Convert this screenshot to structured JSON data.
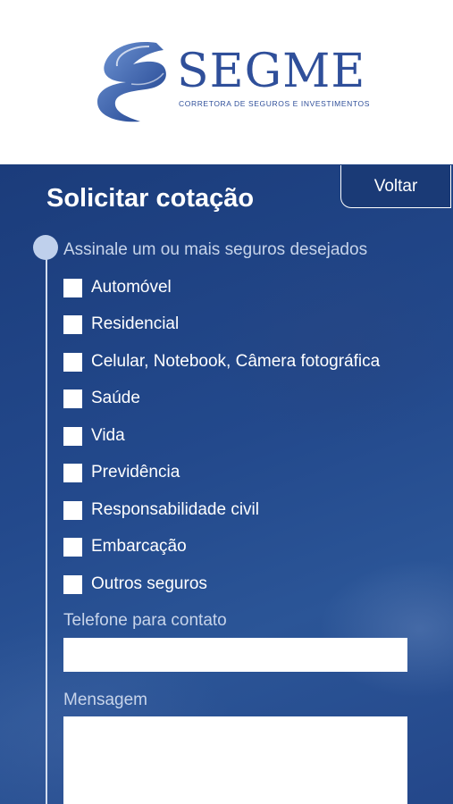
{
  "brand": {
    "name": "SEGME",
    "tagline": "CORRETORA DE SEGUROS E INVESTIMENTOS",
    "color": "#2f4f9a"
  },
  "form": {
    "title": "Solicitar cotação",
    "back_label": "Voltar",
    "prompt": "Assinale um ou mais seguros desejados",
    "options": [
      {
        "label": "Automóvel",
        "checked": false
      },
      {
        "label": "Residencial",
        "checked": false
      },
      {
        "label": "Celular, Notebook, Câmera fotográfica",
        "checked": false
      },
      {
        "label": "Saúde",
        "checked": false
      },
      {
        "label": "Vida",
        "checked": false
      },
      {
        "label": "Previdência",
        "checked": false
      },
      {
        "label": "Responsabilidade civil",
        "checked": false
      },
      {
        "label": "Embarcação",
        "checked": false
      },
      {
        "label": "Outros seguros",
        "checked": false
      }
    ],
    "phone_label": "Telefone para contato",
    "phone_value": "",
    "message_label": "Mensagem",
    "message_value": ""
  },
  "colors": {
    "panel": "#23498c",
    "accent": "#bfd0ec"
  }
}
